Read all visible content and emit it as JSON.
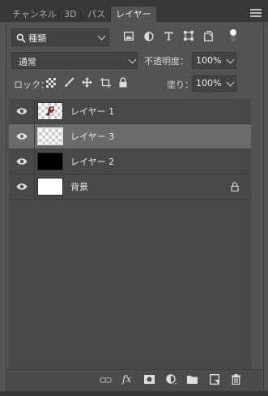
{
  "tabs": [
    {
      "label": "チャンネル"
    },
    {
      "label": "3D"
    },
    {
      "label": "パス"
    },
    {
      "label": "レイヤー"
    }
  ],
  "filter": {
    "kind_label": "種類"
  },
  "blend": {
    "mode": "通常",
    "opacity_label": "不透明度：",
    "opacity_value": "100%"
  },
  "lock": {
    "label": "ロック：",
    "fill_label": "塗り：",
    "fill_value": "100%"
  },
  "layers": [
    {
      "name": "レイヤー 1",
      "thumbnail": "sprite",
      "visible": true,
      "selected": false
    },
    {
      "name": "レイヤー 3",
      "thumbnail": "transparent",
      "visible": true,
      "selected": true
    },
    {
      "name": "レイヤー 2",
      "thumbnail": "black",
      "visible": true,
      "selected": false
    },
    {
      "name": "背景",
      "thumbnail": "white",
      "visible": true,
      "selected": false,
      "locked": true
    }
  ],
  "bottom_actions": [
    {
      "icon": "link-icon"
    },
    {
      "icon": "fx-icon",
      "label": "fx"
    },
    {
      "icon": "mask-icon"
    },
    {
      "icon": "adjustment-icon"
    },
    {
      "icon": "folder-icon"
    },
    {
      "icon": "new-layer-icon"
    },
    {
      "icon": "trash-icon"
    }
  ],
  "colors": {
    "panel_bg": "#535353",
    "list_bg": "#484848",
    "selected_row": "#6b6b6b",
    "tab_bar": "#383838"
  }
}
